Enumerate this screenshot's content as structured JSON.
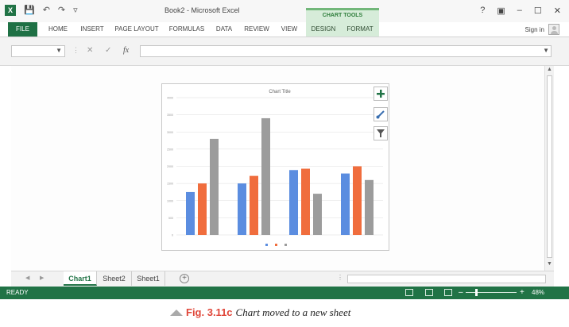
{
  "window": {
    "title": "Book2 - Microsoft Excel",
    "logo_text": "X",
    "contextual_group": "CHART TOOLS",
    "controls": [
      "?",
      "▣",
      "–",
      "☐",
      "✕"
    ]
  },
  "ribbon": {
    "tabs": [
      "FILE",
      "HOME",
      "INSERT",
      "PAGE LAYOUT",
      "FORMULAS",
      "DATA",
      "REVIEW",
      "VIEW",
      "DESIGN",
      "FORMAT"
    ],
    "signin": "Sign in"
  },
  "formula_bar": {
    "name_box_value": "",
    "cancel_glyph": "✕",
    "enter_glyph": "✓",
    "fx_label": "fx",
    "formula_value": ""
  },
  "chart_data": {
    "type": "bar",
    "title": "Chart Title",
    "categories": [
      "",
      "",
      "",
      ""
    ],
    "series": [
      {
        "color": "#5b8de0",
        "values": [
          1250,
          1500,
          1890,
          1790
        ]
      },
      {
        "color": "#f06d3d",
        "values": [
          1500,
          1720,
          1930,
          2000
        ]
      },
      {
        "color": "#9c9c9c",
        "values": [
          2800,
          3400,
          1200,
          1600
        ]
      }
    ],
    "ylim": [
      0,
      4000
    ],
    "yticks": [
      "0",
      "500",
      "1000",
      "1500",
      "2000",
      "2500",
      "3000",
      "3500",
      "4000"
    ],
    "grid": true,
    "legend_position": "bottom"
  },
  "chart_buttons": {
    "elements": "chart-elements",
    "styles": "chart-styles",
    "filters": "chart-filters"
  },
  "sheets": {
    "tabs": [
      "Chart1",
      "Sheet2",
      "Sheet1"
    ],
    "active": "Chart1",
    "add_glyph": "+",
    "nav_prev": "◀",
    "nav_next": "▶"
  },
  "status": {
    "text": "READY",
    "zoom_minus": "–",
    "zoom_plus": "+",
    "zoom": "48%",
    "zoom_fraction": 0.48
  },
  "caption": {
    "label": "Fig. 3.11c",
    "text": "Chart moved to a new sheet"
  }
}
